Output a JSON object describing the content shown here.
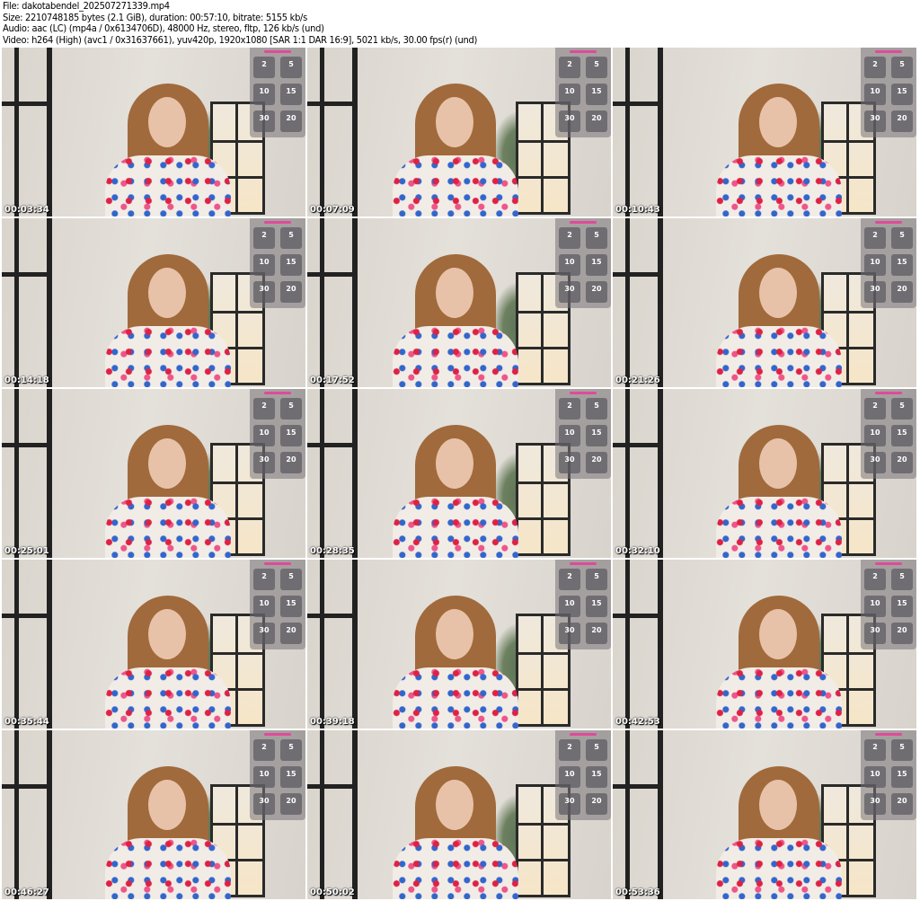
{
  "info": {
    "file": "File: dakotabendel_202507271339.mp4",
    "size": "Size: 2210748185 bytes (2.1 GiB), duration: 00:57:10, bitrate: 5155 kb/s",
    "audio": "Audio: aac (LC) (mp4a / 0x6134706D), 48000 Hz, stereo, fltp, 126 kb/s (und)",
    "video": "Video: h264 (High) (avc1 / 0x31637661), yuv420p, 1920x1080 [SAR 1:1 DAR 16:9], 5021 kb/s, 30.00 fps(r) (und)"
  },
  "thumbnails": [
    {
      "timestamp": "00:03:34"
    },
    {
      "timestamp": "00:07:09"
    },
    {
      "timestamp": "00:10:43"
    },
    {
      "timestamp": "00:14:18"
    },
    {
      "timestamp": "00:17:52"
    },
    {
      "timestamp": "00:21:26"
    },
    {
      "timestamp": "00:25:01"
    },
    {
      "timestamp": "00:28:35"
    },
    {
      "timestamp": "00:32:10"
    },
    {
      "timestamp": "00:35:44"
    },
    {
      "timestamp": "00:39:18"
    },
    {
      "timestamp": "00:42:53"
    },
    {
      "timestamp": "00:46:27"
    },
    {
      "timestamp": "00:50:02"
    },
    {
      "timestamp": "00:53:36"
    }
  ],
  "panel_tiles": [
    "2",
    "5",
    "10",
    "15",
    "30",
    "20"
  ]
}
